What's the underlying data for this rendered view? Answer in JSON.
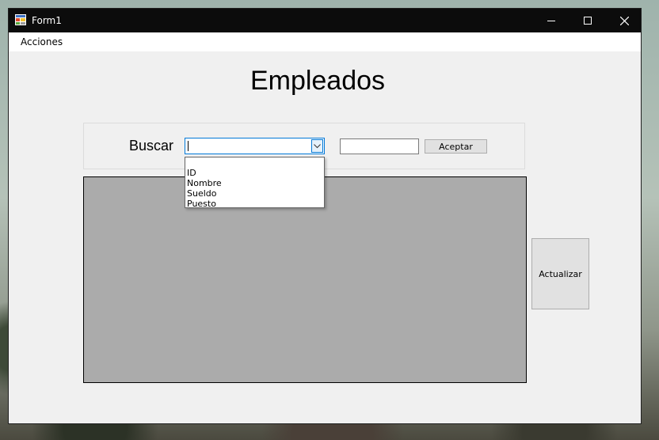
{
  "window": {
    "title": "Form1",
    "minimize_icon": "minimize-icon",
    "maximize_icon": "maximize-icon",
    "close_icon": "close-icon"
  },
  "menu": {
    "items": [
      {
        "label": "Acciones"
      }
    ]
  },
  "main": {
    "heading": "Empleados",
    "search": {
      "label": "Buscar",
      "combo_value": "",
      "options": [
        "ID",
        "Nombre",
        "Sueldo",
        "Puesto"
      ],
      "input_value": "",
      "accept_label": "Aceptar"
    },
    "refresh_label": "Actualizar"
  },
  "colors": {
    "titlebar": "#0c0c0c",
    "form_background": "#f0f0f0",
    "grid_background": "#ababab",
    "focus_accent": "#0078d7"
  }
}
